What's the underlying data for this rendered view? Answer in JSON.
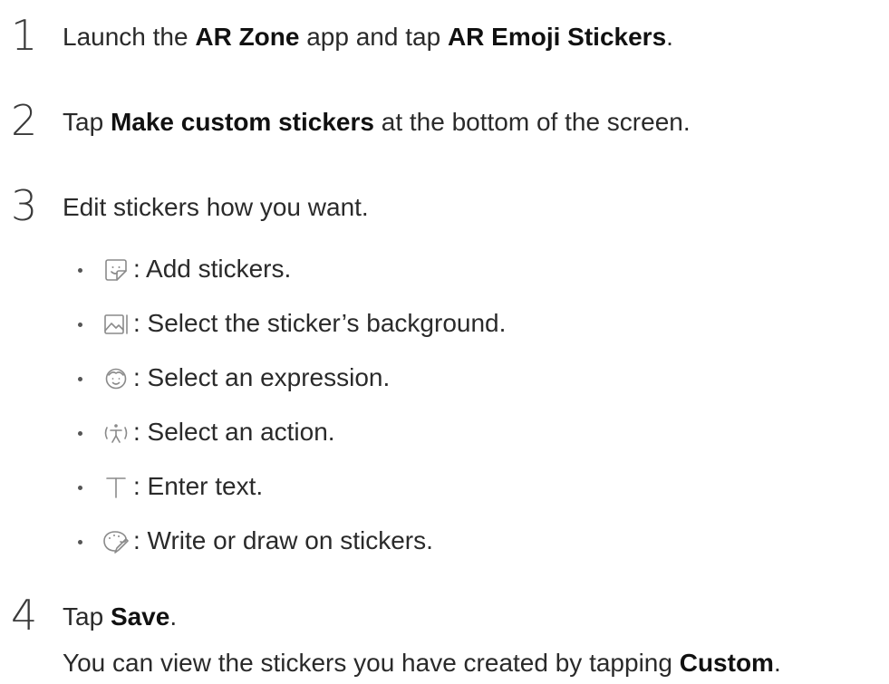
{
  "steps": [
    {
      "number": "1",
      "pre": "Launch the ",
      "bold1": "AR Zone",
      "mid": " app and tap ",
      "bold2": "AR Emoji Stickers",
      "post": "."
    },
    {
      "number": "2",
      "pre": "Tap ",
      "bold1": "Make custom stickers",
      "post": " at the bottom of the screen."
    },
    {
      "number": "3",
      "text": "Edit stickers how you want."
    },
    {
      "number": "4",
      "pre": "Tap ",
      "bold1": "Save",
      "post": "."
    }
  ],
  "bullets": [
    {
      "icon": "sticker-icon",
      "text": ": Add stickers."
    },
    {
      "icon": "background-image-icon",
      "text": ": Select the sticker’s background."
    },
    {
      "icon": "face-expression-icon",
      "text": ": Select an expression."
    },
    {
      "icon": "action-figure-icon",
      "text": ": Select an action."
    },
    {
      "icon": "text-icon",
      "text": ": Enter text."
    },
    {
      "icon": "draw-palette-icon",
      "text": ": Write or draw on stickers."
    }
  ],
  "note": {
    "pre": "You can view the stickers you have created by tapping ",
    "bold": "Custom",
    "post": "."
  }
}
